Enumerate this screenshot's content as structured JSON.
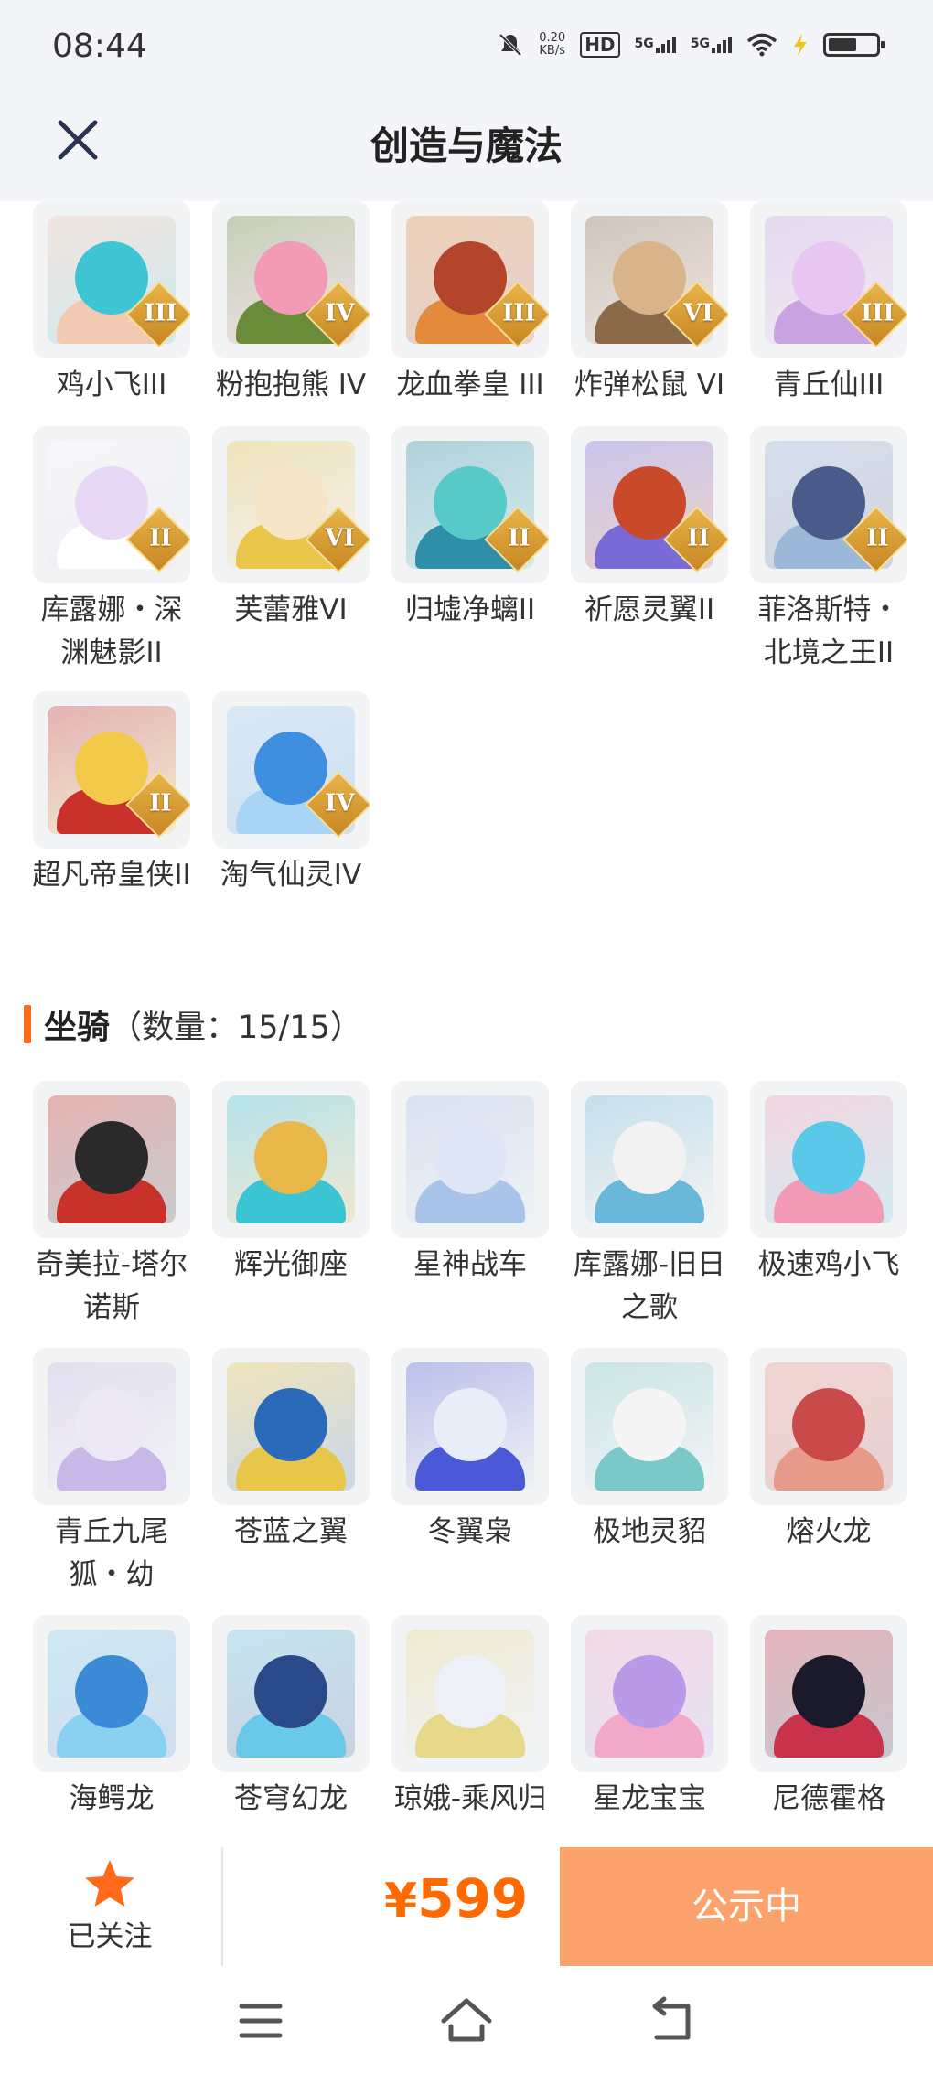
{
  "status_bar": {
    "time": "08:44",
    "net_speed_value": "0.20",
    "net_speed_unit": "KB/s",
    "hd_label": "HD",
    "sim1_label": "5G",
    "sim2_label": "5G"
  },
  "header": {
    "title": "创造与魔法",
    "close_icon": "close-icon"
  },
  "pets": [
    {
      "name": "鸡小飞III",
      "tier": "III",
      "colors": [
        "#3fc4d4",
        "#f2c9b3"
      ]
    },
    {
      "name": "粉抱抱熊 IV",
      "tier": "IV",
      "colors": [
        "#f29ab6",
        "#6a8b3a"
      ]
    },
    {
      "name": "龙血拳皇 III",
      "tier": "III",
      "colors": [
        "#b3452a",
        "#e38b3d"
      ]
    },
    {
      "name": "炸弹松鼠 VI",
      "tier": "VI",
      "colors": [
        "#d9b48a",
        "#8a6a4a"
      ]
    },
    {
      "name": "青丘仙III",
      "tier": "III",
      "colors": [
        "#e8c6f2",
        "#c8a3e0"
      ]
    },
    {
      "name": "库露娜・深渊魅影II",
      "tier": "II",
      "colors": [
        "#e9d8f5",
        "#ffffff"
      ]
    },
    {
      "name": "芙蕾雅VI",
      "tier": "VI",
      "colors": [
        "#f5e6c8",
        "#e9c64a"
      ]
    },
    {
      "name": "归墟净螭II",
      "tier": "II",
      "colors": [
        "#58c9c9",
        "#2f8fa8"
      ]
    },
    {
      "name": "祈愿灵翼II",
      "tier": "II",
      "colors": [
        "#c94a2a",
        "#7a6ad6"
      ]
    },
    {
      "name": "菲洛斯特・北境之王II",
      "tier": "II",
      "colors": [
        "#4a5a8a",
        "#9bb8d9"
      ]
    },
    {
      "name": "超凡帝皇侠II",
      "tier": "II",
      "colors": [
        "#f2c948",
        "#c8322a"
      ]
    },
    {
      "name": "淘气仙灵IV",
      "tier": "IV",
      "colors": [
        "#3e8fe0",
        "#a8d4f5"
      ]
    }
  ],
  "mounts_section": {
    "title": "坐骑",
    "count_text": "（数量：15/15）"
  },
  "mounts": [
    {
      "name": "奇美拉-塔尔诺斯",
      "colors": [
        "#2a2a2a",
        "#c8322a"
      ]
    },
    {
      "name": "辉光御座",
      "colors": [
        "#e8b84a",
        "#3ac4d4"
      ]
    },
    {
      "name": "星神战车",
      "colors": [
        "#dfe6f5",
        "#a8c4e8"
      ]
    },
    {
      "name": "库露娜-旧日之歌",
      "colors": [
        "#f2f2f2",
        "#6ab8d9"
      ]
    },
    {
      "name": "极速鸡小飞",
      "colors": [
        "#5ac8e8",
        "#f29ab6"
      ]
    },
    {
      "name": "青丘九尾狐・幼",
      "colors": [
        "#ede8f5",
        "#c8b8e8"
      ]
    },
    {
      "name": "苍蓝之翼",
      "colors": [
        "#2a6ab8",
        "#e8c64a"
      ]
    },
    {
      "name": "冬翼枭",
      "colors": [
        "#e8eef8",
        "#4a5ad6"
      ]
    },
    {
      "name": "极地灵貂",
      "colors": [
        "#f5f5f5",
        "#7ac8c8"
      ]
    },
    {
      "name": "熔火龙",
      "colors": [
        "#c84a4a",
        "#e89a8a"
      ]
    },
    {
      "name": "海鳄龙",
      "colors": [
        "#3a8ad6",
        "#8ad0f0"
      ]
    },
    {
      "name": "苍穹幻龙",
      "colors": [
        "#2a4a8a",
        "#6ac8e8"
      ]
    },
    {
      "name": "琼娥-乘风归",
      "colors": [
        "#eef0f8",
        "#e8d88a"
      ]
    },
    {
      "name": "星龙宝宝",
      "colors": [
        "#b89ae8",
        "#f2a8c8"
      ]
    },
    {
      "name": "尼德霍格",
      "colors": [
        "#1a1a2a",
        "#c8324a"
      ]
    }
  ],
  "action_bar": {
    "follow_label": "已关注",
    "follow_icon": "star-icon",
    "price_symbol": "¥",
    "price_value": "599",
    "status_button": "公示中",
    "accent_color": "#ff6a00",
    "button_color": "#fca26d"
  },
  "nav_bar": {
    "menu_icon": "menu-icon",
    "home_icon": "home-icon",
    "back_icon": "back-icon"
  }
}
